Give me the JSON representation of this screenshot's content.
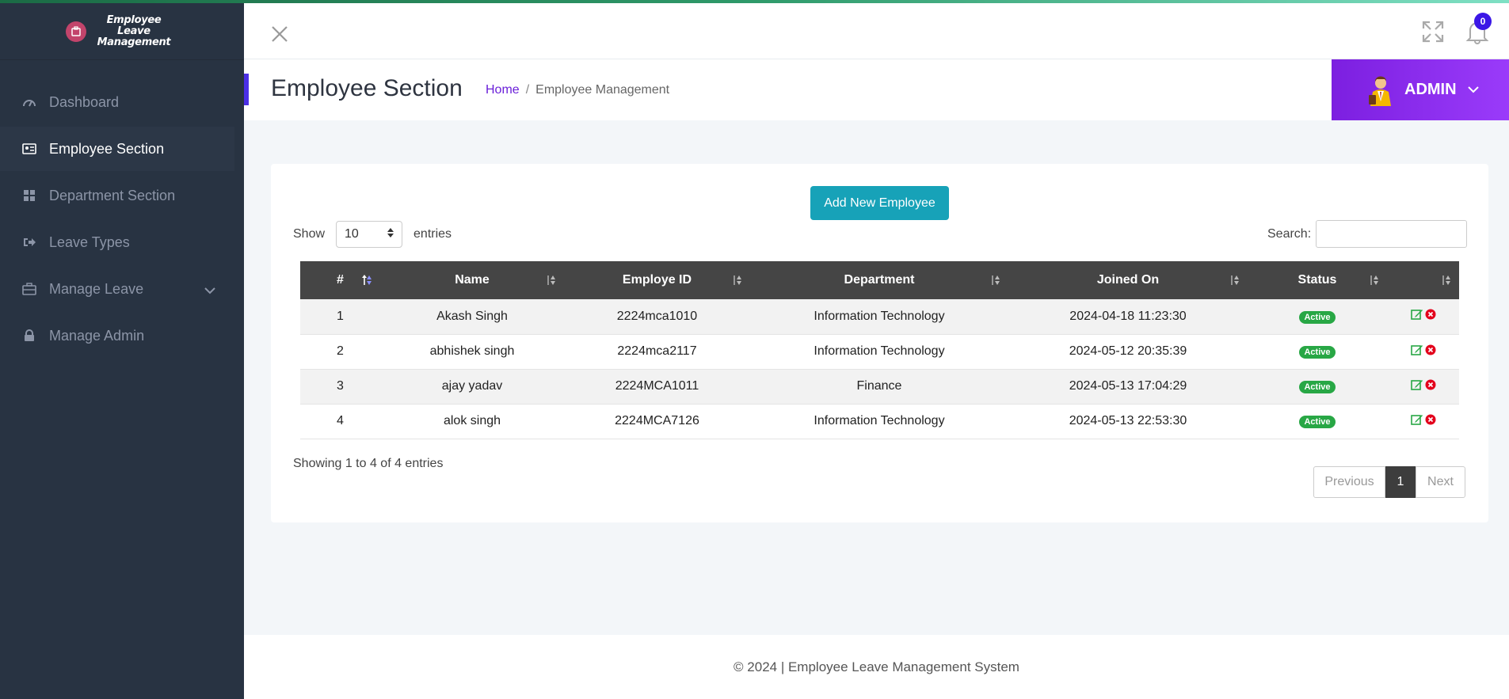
{
  "app": {
    "logo_line1": "Employee Leave",
    "logo_line2": "Management"
  },
  "sidebar": {
    "items": [
      {
        "label": "Dashboard",
        "icon": "gauge-icon",
        "active": false
      },
      {
        "label": "Employee Section",
        "icon": "id-card-icon",
        "active": true
      },
      {
        "label": "Department Section",
        "icon": "grid-icon",
        "active": false
      },
      {
        "label": "Leave Types",
        "icon": "sign-out-icon",
        "active": false
      },
      {
        "label": "Manage Leave",
        "icon": "briefcase-icon",
        "active": false,
        "has_submenu": true
      },
      {
        "label": "Manage Admin",
        "icon": "lock-icon",
        "active": false
      }
    ]
  },
  "header": {
    "notification_count": "0"
  },
  "titlebar": {
    "title": "Employee Section",
    "breadcrumb_home": "Home",
    "breadcrumb_sep": "/",
    "breadcrumb_current": "Employee Management",
    "user_label": "ADMIN"
  },
  "card": {
    "add_button": "Add New Employee",
    "show_label": "Show",
    "show_value": "10",
    "entries_label": "entries",
    "search_label": "Search:",
    "search_value": "",
    "info": "Showing 1 to 4 of 4 entries",
    "pager": {
      "previous": "Previous",
      "current": "1",
      "next": "Next"
    }
  },
  "table": {
    "columns": [
      "#",
      "Name",
      "Employe ID",
      "Department",
      "Joined On",
      "Status",
      ""
    ],
    "rows": [
      {
        "num": "1",
        "name": "Akash Singh",
        "emp_id": "2224mca1010",
        "department": "Information Technology",
        "joined": "2024-04-18 11:23:30",
        "status": "Active"
      },
      {
        "num": "2",
        "name": "abhishek singh",
        "emp_id": "2224mca2117",
        "department": "Information Technology",
        "joined": "2024-05-12 20:35:39",
        "status": "Active"
      },
      {
        "num": "3",
        "name": "ajay yadav",
        "emp_id": "2224MCA1011",
        "department": "Finance",
        "joined": "2024-05-13 17:04:29",
        "status": "Active"
      },
      {
        "num": "4",
        "name": "alok singh",
        "emp_id": "2224MCA7126",
        "department": "Information Technology",
        "joined": "2024-05-13 22:53:30",
        "status": "Active"
      }
    ]
  },
  "footer": {
    "text": "© 2024 | Employee Leave Management System"
  },
  "colors": {
    "sidebar_bg": "#283342",
    "accent_purple": "#7c1fe0",
    "button_teal": "#17a2b8",
    "status_green": "#28a745",
    "table_header": "#454545"
  }
}
